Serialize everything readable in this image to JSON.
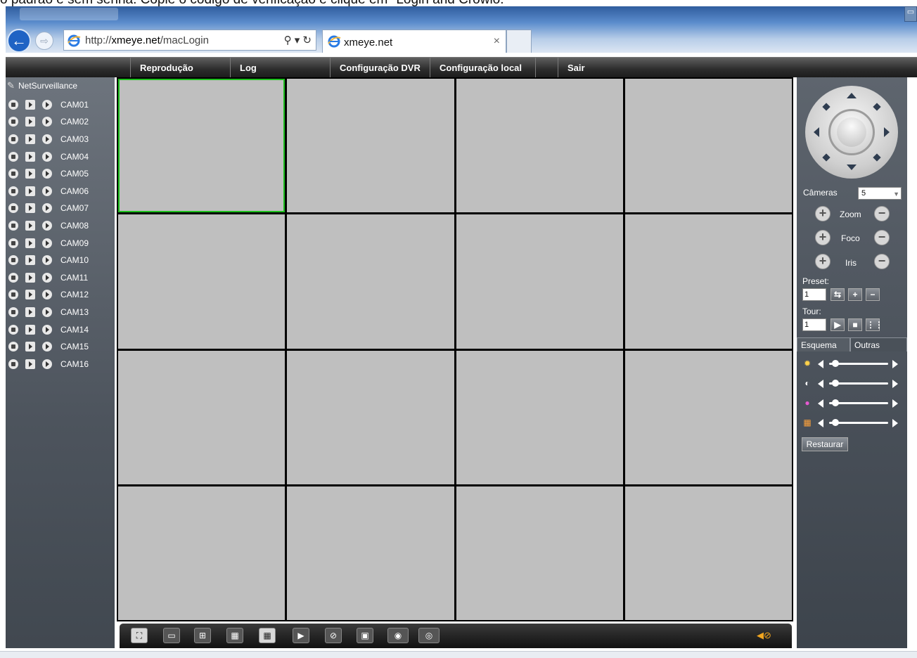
{
  "caption": "o padrão é sem senha. Copie o código de verificação e clique em \"Login and Crowlo.",
  "browser": {
    "url_prefix": "http://",
    "url_host": "xmeye.net",
    "url_path": "/macLogin",
    "tab_title": "xmeye.net",
    "url_tools": "⚲ ▾ ↻"
  },
  "menu": [
    "Reprodução",
    "Log",
    "Configuração DVR",
    "Configuração local",
    "Sair"
  ],
  "device": {
    "root": "NetSurveillance",
    "cameras": [
      "CAM01",
      "CAM02",
      "CAM03",
      "CAM04",
      "CAM05",
      "CAM06",
      "CAM07",
      "CAM08",
      "CAM09",
      "CAM10",
      "CAM11",
      "CAM12",
      "CAM13",
      "CAM14",
      "CAM15",
      "CAM16"
    ]
  },
  "ptz": {
    "cameras_label": "Câmeras",
    "camera_value": "5",
    "zoom_label": "Zoom",
    "focus_label": "Foco",
    "iris_label": "Iris",
    "preset_label": "Preset:",
    "preset_value": "1",
    "tour_label": "Tour:",
    "tour_value": "1"
  },
  "tabs": [
    "Esquema",
    "Outras"
  ],
  "image_controls": {
    "brightness": 0.05,
    "contrast": 0.05,
    "saturation": 0.05,
    "hue": 0.05,
    "restore_label": "Restaurar"
  },
  "colors": {
    "selected_cell_border": "#1dbf1d",
    "video_cell": "#bfbfbf",
    "speaker": "#f1a51f"
  }
}
